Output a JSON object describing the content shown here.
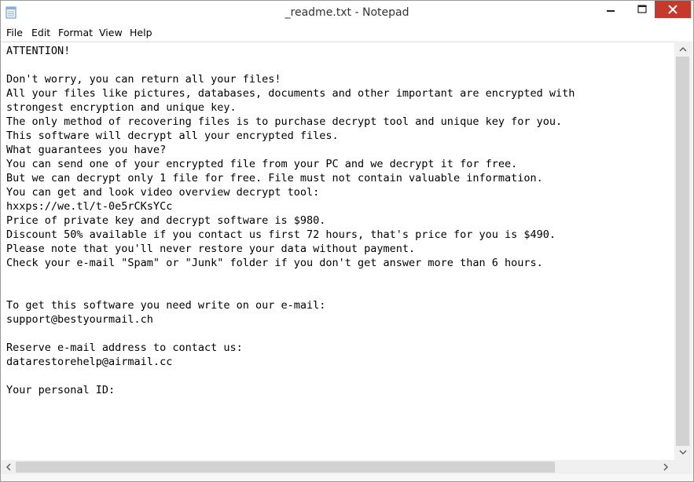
{
  "window": {
    "title": "_readme.txt - Notepad",
    "icon": "notepad-icon"
  },
  "menu": {
    "items": [
      {
        "label": "File"
      },
      {
        "label": "Edit"
      },
      {
        "label": "Format"
      },
      {
        "label": "View"
      },
      {
        "label": "Help"
      }
    ]
  },
  "document": {
    "lines": [
      "ATTENTION!",
      "",
      "Don't worry, you can return all your files!",
      "All your files like pictures, databases, documents and other important are encrypted with",
      "strongest encryption and unique key.",
      "The only method of recovering files is to purchase decrypt tool and unique key for you.",
      "This software will decrypt all your encrypted files.",
      "What guarantees you have?",
      "You can send one of your encrypted file from your PC and we decrypt it for free.",
      "But we can decrypt only 1 file for free. File must not contain valuable information.",
      "You can get and look video overview decrypt tool:",
      "hxxps://we.tl/t-0e5rCKsYCc",
      "Price of private key and decrypt software is $980.",
      "Discount 50% available if you contact us first 72 hours, that's price for you is $490.",
      "Please note that you'll never restore your data without payment.",
      "Check your e-mail \"Spam\" or \"Junk\" folder if you don't get answer more than 6 hours.",
      "",
      "",
      "To get this software you need write on our e-mail:",
      "support@bestyourmail.ch",
      "",
      "Reserve e-mail address to contact us:",
      "datarestorehelp@airmail.cc",
      "",
      "Your personal ID:"
    ]
  },
  "colors": {
    "close_button": "#c7392b",
    "scrollbar_thumb": "#d2d2d2",
    "scrollbar_track": "#f0f0f0"
  },
  "icons": [
    "notepad-icon",
    "minimize-icon",
    "maximize-icon",
    "close-icon",
    "chevron-up-icon",
    "chevron-down-icon",
    "chevron-left-icon",
    "chevron-right-icon"
  ]
}
